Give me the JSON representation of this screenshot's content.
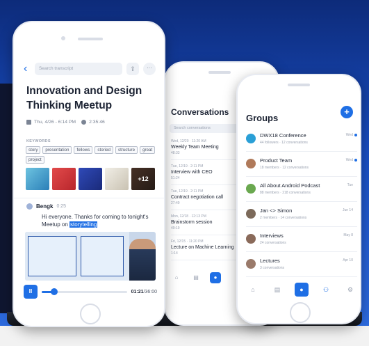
{
  "phone1": {
    "search_placeholder": "Search transcript",
    "share_icon": "share-icon",
    "more_icon": "more-icon",
    "title": "Innovation and Design Thinking Meetup",
    "date": "Thu, 4/26 - 6:14 PM",
    "duration": "2:35:46",
    "keywords_label": "KEYWORDS",
    "keywords": [
      "story",
      "presentation",
      "fellows",
      "storied",
      "structure",
      "great",
      "project"
    ],
    "more_count": "+12",
    "speaker_name": "Bengk",
    "speaker_time": "0:25",
    "utterance_pre": "Hi everyone. Thanks for coming to tonight's Meetup on ",
    "utterance_highlight": "storytelling",
    "pause_label": "II",
    "elapsed": "01:21",
    "total": "/36:00",
    "progress": 0.15
  },
  "phone2": {
    "title": "Conversations",
    "search_placeholder": "Search conversations",
    "items": [
      {
        "date": "Wed, 12/20 · 11:20 AM",
        "title": "Weekly Team Meeting",
        "dur": "48:33"
      },
      {
        "date": "Tue, 12/19 · 2:11 PM",
        "title": "Interview with CEO",
        "dur": "51:24"
      },
      {
        "date": "Tue, 12/19 · 2:11 PM",
        "title": "Contract negotiation call",
        "dur": "27:49"
      },
      {
        "date": "Mon, 12/18 · 12:13 PM",
        "title": "Brainstorm session",
        "dur": "49:19"
      },
      {
        "date": "Fri, 12/15 · 11:20 PM",
        "title": "Lecture on Machine Learning",
        "dur": "1:14"
      }
    ]
  },
  "phone3": {
    "title": "Groups",
    "add_label": "+",
    "groups": [
      {
        "name": "DWX18 Conference",
        "sub": "44 followers · 12 conversations",
        "date": "Wed",
        "dot": true,
        "color": "#2a9fd6"
      },
      {
        "name": "Product Team",
        "sub": "18 members · 12 conversations",
        "date": "Wed",
        "dot": true,
        "color": "#b07a5a"
      },
      {
        "name": "All About Android Podcast",
        "sub": "88 members · 218 conversations",
        "date": "Tue",
        "dot": false,
        "color": "#6aa84f"
      },
      {
        "name": "Jan <> Simon",
        "sub": "2 members · 14 conversations",
        "date": "Jun 14",
        "dot": false,
        "color": "#7c6a5a"
      },
      {
        "name": "Interviews",
        "sub": "24 conversations",
        "date": "May 8",
        "dot": false,
        "color": "#8a6a5a"
      },
      {
        "name": "Lectures",
        "sub": "3 conversations",
        "date": "Apr 10",
        "dot": false,
        "color": "#9a7a6a"
      }
    ]
  }
}
